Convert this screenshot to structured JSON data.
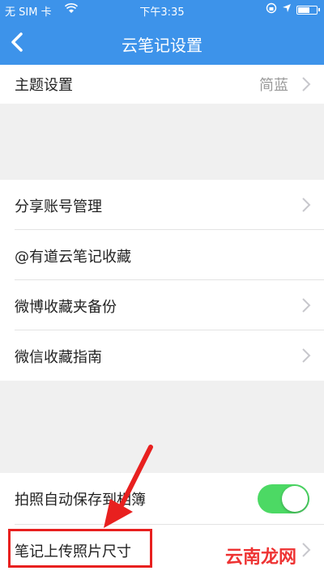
{
  "status_bar": {
    "carrier": "无 SIM 卡",
    "time": "下午3:35"
  },
  "nav": {
    "title": "云笔记设置",
    "back_icon": "chevron-left-icon"
  },
  "rows": [
    {
      "label": "主题设置",
      "value": "简蓝"
    },
    {
      "label": "分享账号管理"
    },
    {
      "label": "@有道云笔记收藏"
    },
    {
      "label": "微博收藏夹备份"
    },
    {
      "label": "微信收藏指南"
    },
    {
      "label": "拍照自动保存到相簿",
      "toggle": true
    },
    {
      "label": "笔记上传照片尺寸"
    }
  ],
  "annotation": {
    "color": "#e8201f"
  },
  "watermark": "云南龙网",
  "colors": {
    "accent": "#3d93ea",
    "toggle_on": "#4cd964"
  }
}
